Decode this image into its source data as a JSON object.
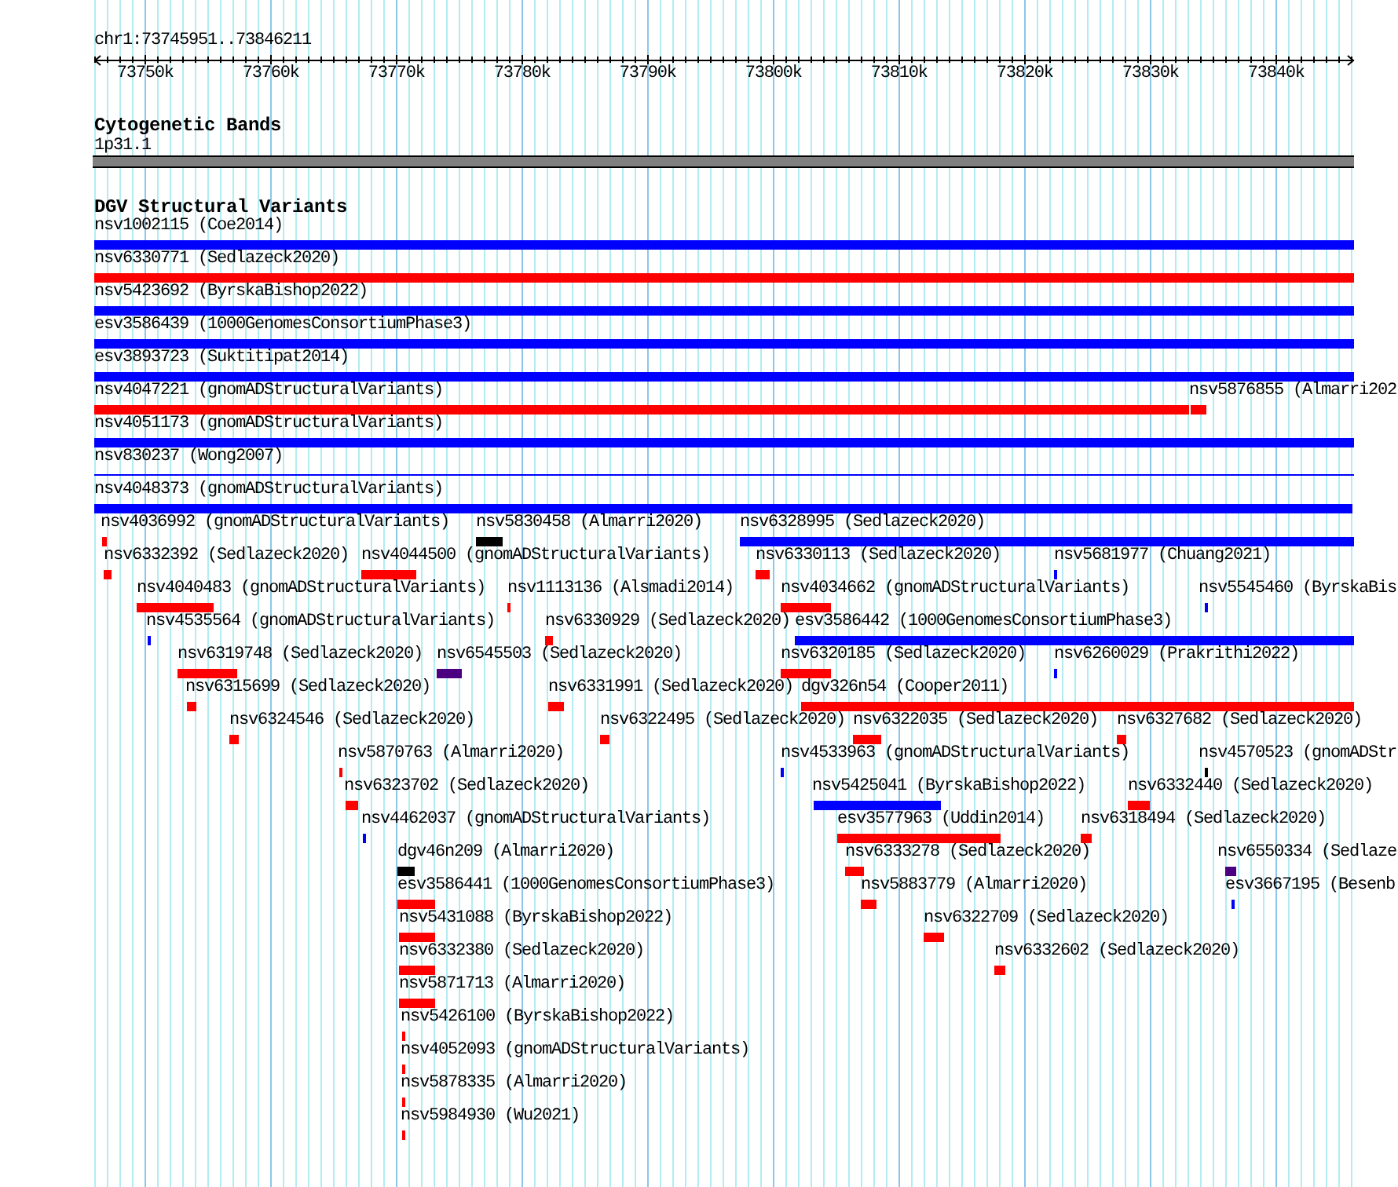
{
  "ruler": {
    "location": "chr1:73745951..73846211",
    "tick_labels": [
      "73750k",
      "73760k",
      "73770k",
      "73780k",
      "73790k",
      "73800k",
      "73810k",
      "73820k",
      "73830k",
      "73840k"
    ]
  },
  "cytogenetic_bands": {
    "title": "Cytogenetic Bands",
    "bands": [
      {
        "name": "1p31.1"
      }
    ]
  },
  "dgv_structural_variants": {
    "title": "DGV Structural Variants",
    "rows": [
      {
        "features": [
          {
            "label": "nsv1002115 (Coe2014)",
            "color": "#0000ff",
            "kind": "bar"
          }
        ]
      },
      {
        "features": [
          {
            "label": "nsv6330771 (Sedlazeck2020)",
            "color": "#ff0000",
            "kind": "bar"
          }
        ]
      },
      {
        "features": [
          {
            "label": "nsv5423692 (ByrskaBishop2022)",
            "color": "#0000ff",
            "kind": "bar"
          }
        ]
      },
      {
        "features": [
          {
            "label": "esv3586439 (1000GenomesConsortiumPhase3)",
            "color": "#0000ff",
            "kind": "bar"
          }
        ]
      },
      {
        "features": [
          {
            "label": "esv3893723 (Suktitipat2014)",
            "color": "#0000ff",
            "kind": "bar"
          }
        ]
      },
      {
        "features": [
          {
            "label": "nsv4047221 (gnomADStructuralVariants)",
            "color": "#ff0000",
            "kind": "bar"
          },
          {
            "label": "nsv5876855 (Almarri202",
            "color": "#ff0000",
            "kind": "bar"
          }
        ]
      },
      {
        "features": [
          {
            "label": "nsv4051173 (gnomADStructuralVariants)",
            "color": "#0000ff",
            "kind": "bar"
          }
        ]
      },
      {
        "features": [
          {
            "label": "nsv830237 (Wong2007)",
            "color": "#0000ff",
            "kind": "line"
          }
        ]
      },
      {
        "features": [
          {
            "label": "nsv4048373 (gnomADStructuralVariants)",
            "color": "#0000ff",
            "kind": "bar"
          }
        ]
      },
      {
        "features": [
          {
            "label": "nsv4036992 (gnomADStructuralVariants)",
            "color": "#ff0000",
            "kind": "bar"
          },
          {
            "label": "nsv5830458 (Almarri2020)",
            "color": "#000000",
            "kind": "bar"
          },
          {
            "label": "nsv6328995 (Sedlazeck2020)",
            "color": "#0000ff",
            "kind": "bar"
          }
        ]
      },
      {
        "features": [
          {
            "label": "nsv6332392 (Sedlazeck2020)",
            "color": "#ff0000",
            "kind": "bar"
          },
          {
            "label": "nsv4044500 (gnomADStructuralVariants)",
            "color": "#ff0000",
            "kind": "bar"
          },
          {
            "label": "nsv6330113 (Sedlazeck2020)",
            "color": "#ff0000",
            "kind": "bar"
          },
          {
            "label": "nsv5681977 (Chuang2021)",
            "color": "#0000ff",
            "kind": "bar"
          }
        ]
      },
      {
        "features": [
          {
            "label": "nsv4040483 (gnomADStructuralVariants)",
            "color": "#ff0000",
            "kind": "bar"
          },
          {
            "label": "nsv1113136 (Alsmadi2014)",
            "color": "#ff0000",
            "kind": "bar"
          },
          {
            "label": "nsv4034662 (gnomADStructuralVariants)",
            "color": "#ff0000",
            "kind": "bar"
          },
          {
            "label": "nsv5545460 (ByrskaBis",
            "color": "#0000ff",
            "kind": "bar"
          }
        ]
      },
      {
        "features": [
          {
            "label": "nsv4535564 (gnomADStructuralVariants)",
            "color": "#0000ff",
            "kind": "bar"
          },
          {
            "label": "nsv6330929 (Sedlazeck2020)",
            "color": "#ff0000",
            "kind": "bar"
          },
          {
            "label": "esv3586442 (1000GenomesConsortiumPhase3)",
            "color": "#0000ff",
            "kind": "bar"
          }
        ]
      },
      {
        "features": [
          {
            "label": "nsv6319748 (Sedlazeck2020)",
            "color": "#ff0000",
            "kind": "bar"
          },
          {
            "label": "nsv6545503 (Sedlazeck2020)",
            "color": "#4b0082",
            "kind": "bar"
          },
          {
            "label": "nsv6320185 (Sedlazeck2020)",
            "color": "#ff0000",
            "kind": "bar"
          },
          {
            "label": "nsv6260029 (Prakrithi2022)",
            "color": "#0000ff",
            "kind": "bar"
          }
        ]
      },
      {
        "features": [
          {
            "label": "nsv6315699 (Sedlazeck2020)",
            "color": "#ff0000",
            "kind": "bar"
          },
          {
            "label": "nsv6331991 (Sedlazeck2020)",
            "color": "#ff0000",
            "kind": "bar"
          },
          {
            "label": "dgv326n54 (Cooper2011)",
            "color": "#ff0000",
            "kind": "bar"
          }
        ]
      },
      {
        "features": [
          {
            "label": "nsv6324546 (Sedlazeck2020)",
            "color": "#ff0000",
            "kind": "bar"
          },
          {
            "label": "nsv6322495 (Sedlazeck2020)",
            "color": "#ff0000",
            "kind": "bar"
          },
          {
            "label": "nsv6322035 (Sedlazeck2020)",
            "color": "#ff0000",
            "kind": "bar"
          },
          {
            "label": "nsv6327682 (Sedlazeck2020)",
            "color": "#ff0000",
            "kind": "bar"
          }
        ]
      },
      {
        "features": [
          {
            "label": "nsv5870763 (Almarri2020)",
            "color": "#ff0000",
            "kind": "bar"
          },
          {
            "label": "nsv4533963 (gnomADStructuralVariants)",
            "color": "#0000ff",
            "kind": "bar"
          },
          {
            "label": "nsv4570523 (gnomADStr",
            "color": "#000000",
            "kind": "bar"
          }
        ]
      },
      {
        "features": [
          {
            "label": "nsv6323702 (Sedlazeck2020)",
            "color": "#ff0000",
            "kind": "bar"
          },
          {
            "label": "nsv5425041 (ByrskaBishop2022)",
            "color": "#0000ff",
            "kind": "bar"
          },
          {
            "label": "nsv6332440 (Sedlazeck2020)",
            "color": "#ff0000",
            "kind": "bar"
          }
        ]
      },
      {
        "features": [
          {
            "label": "nsv4462037 (gnomADStructuralVariants)",
            "color": "#0000ff",
            "kind": "bar"
          },
          {
            "label": "esv3577963 (Uddin2014)",
            "color": "#ff0000",
            "kind": "bar"
          },
          {
            "label": "nsv6318494 (Sedlazeck2020)",
            "color": "#ff0000",
            "kind": "bar"
          }
        ]
      },
      {
        "features": [
          {
            "label": "dgv46n209 (Almarri2020)",
            "color": "#000000",
            "kind": "bar"
          },
          {
            "label": "nsv6333278 (Sedlazeck2020)",
            "color": "#ff0000",
            "kind": "bar"
          },
          {
            "label": "nsv6550334 (Sedlaze",
            "color": "#4b0082",
            "kind": "bar"
          }
        ]
      },
      {
        "features": [
          {
            "label": "esv3586441 (1000GenomesConsortiumPhase3)",
            "color": "#ff0000",
            "kind": "bar"
          },
          {
            "label": "nsv5883779 (Almarri2020)",
            "color": "#ff0000",
            "kind": "bar"
          },
          {
            "label": "esv3667195 (Besenb",
            "color": "#0000ff",
            "kind": "bar"
          }
        ]
      },
      {
        "features": [
          {
            "label": "nsv5431088 (ByrskaBishop2022)",
            "color": "#ff0000",
            "kind": "bar"
          },
          {
            "label": "nsv6322709 (Sedlazeck2020)",
            "color": "#ff0000",
            "kind": "bar"
          }
        ]
      },
      {
        "features": [
          {
            "label": "nsv6332380 (Sedlazeck2020)",
            "color": "#ff0000",
            "kind": "bar"
          },
          {
            "label": "nsv6332602 (Sedlazeck2020)",
            "color": "#ff0000",
            "kind": "bar"
          }
        ]
      },
      {
        "features": [
          {
            "label": "nsv5871713 (Almarri2020)",
            "color": "#ff0000",
            "kind": "bar"
          }
        ]
      },
      {
        "features": [
          {
            "label": "nsv5426100 (ByrskaBishop2022)",
            "color": "#ff0000",
            "kind": "bar"
          }
        ]
      },
      {
        "features": [
          {
            "label": "nsv4052093 (gnomADStructuralVariants)",
            "color": "#ff0000",
            "kind": "bar"
          }
        ]
      },
      {
        "features": [
          {
            "label": "nsv5878335 (Almarri2020)",
            "color": "#ff0000",
            "kind": "bar"
          }
        ]
      },
      {
        "features": [
          {
            "label": "nsv5984930 (Wu2021)",
            "color": "#ff0000",
            "kind": "bar"
          }
        ]
      }
    ]
  }
}
